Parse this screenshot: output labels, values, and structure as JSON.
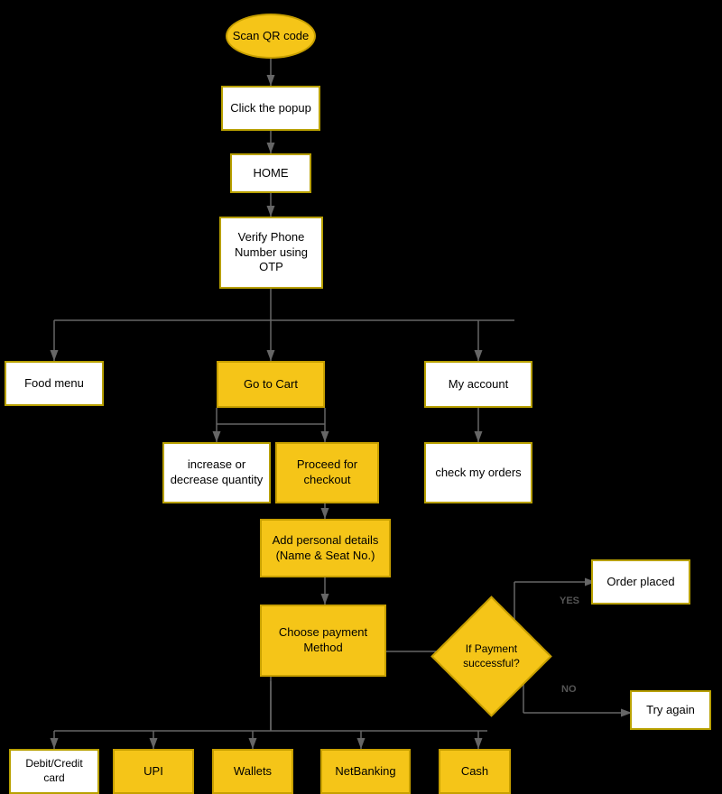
{
  "nodes": {
    "scan_qr": {
      "label": "Scan QR code"
    },
    "click_popup": {
      "label": "Click the popup"
    },
    "home": {
      "label": "HOME"
    },
    "verify_phone": {
      "label": "Verify Phone Number using OTP"
    },
    "food_menu": {
      "label": "Food menu"
    },
    "go_to_cart": {
      "label": "Go to Cart"
    },
    "my_account": {
      "label": "My account"
    },
    "increase_decrease": {
      "label": "increase or decrease quantity"
    },
    "proceed_checkout": {
      "label": "Proceed for checkout"
    },
    "check_orders": {
      "label": "check my orders"
    },
    "add_personal": {
      "label": "Add personal details (Name & Seat No.)"
    },
    "choose_payment": {
      "label": "Choose payment Method"
    },
    "if_payment": {
      "label": "If Payment successful?"
    },
    "order_placed": {
      "label": "Order placed"
    },
    "try_again": {
      "label": "Try again"
    },
    "debit_credit": {
      "label": "Debit/Credit card"
    },
    "upi": {
      "label": "UPI"
    },
    "wallets": {
      "label": "Wallets"
    },
    "netbanking": {
      "label": "NetBanking"
    },
    "cash": {
      "label": "Cash"
    }
  },
  "arrow_labels": {
    "yes": "YES",
    "no": "NO"
  }
}
